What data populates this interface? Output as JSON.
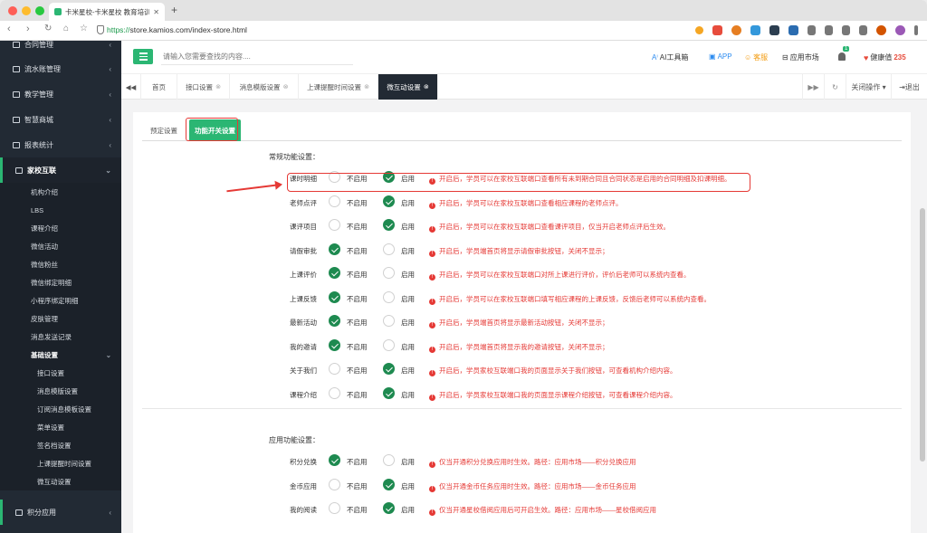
{
  "browser": {
    "tab_title": "卡米星校-卡米星校 教育培训机",
    "tab_close": "✕",
    "new_tab": "+",
    "url_scheme": "https://",
    "url_rest": "store.kamios.com/index-store.html"
  },
  "sidebar": {
    "items": [
      {
        "label": "合同管理",
        "icon": "contract-icon"
      },
      {
        "label": "流水账管理",
        "icon": "ledger-icon"
      },
      {
        "label": "教学管理",
        "icon": "calendar-icon"
      },
      {
        "label": "智慧商城",
        "icon": "shop-icon"
      },
      {
        "label": "报表统计",
        "icon": "chart-icon"
      },
      {
        "label": "家校互联",
        "icon": "chat-icon"
      },
      {
        "label": "积分应用",
        "icon": "points-icon"
      }
    ],
    "sub_items": [
      "机构介绍",
      "LBS",
      "课程介绍",
      "微信活动",
      "微信粉丝",
      "微信绑定明细",
      "小程序绑定明细",
      "皮肤管理",
      "消息发送记录",
      "基础设置"
    ],
    "sub2_items": [
      "接口设置",
      "消息模版设置",
      "订阅消息模板设置",
      "菜单设置",
      "签名档设置",
      "上课提醒时间设置",
      "微互动设置"
    ],
    "chevron": "‹",
    "chevron_open": "⌄"
  },
  "header": {
    "search_placeholder": "请输入您需要查找的内容....",
    "ai_label": "AI工具箱",
    "app_label": "APP",
    "service_label": "客服",
    "market_label": "应用市场",
    "bell_badge": "1",
    "health_label": "健康值",
    "health_value": "235"
  },
  "page_tabs": {
    "prev": "◀◀",
    "tabs": [
      {
        "label": "首页",
        "closable": false
      },
      {
        "label": "接口设置",
        "closable": true
      },
      {
        "label": "消息模版设置",
        "closable": true
      },
      {
        "label": "上课提醒时间设置",
        "closable": true
      },
      {
        "label": "微互动设置",
        "closable": true
      }
    ],
    "next": "▶▶",
    "refresh": "↻",
    "close_ops": "关闭操作 ▾",
    "logout": "退出"
  },
  "subtabs": [
    "预定设置",
    "功能开关设置"
  ],
  "sections": [
    {
      "title": "常规功能设置：",
      "rows": [
        {
          "label": "课时明细",
          "enabled": true,
          "hint": "开启后，学员可以在家校互联端口查看所有未到期合同且合同状态是启用的合同明细及扣课明细。"
        },
        {
          "label": "老师点评",
          "enabled": true,
          "hint": "开启后，学员可以在家校互联端口查看相应课程的老师点评。"
        },
        {
          "label": "课评项目",
          "enabled": true,
          "hint": "开启后，学员可以在家校互联端口查看课评项目，仅当开启老师点评后生效。"
        },
        {
          "label": "请假审批",
          "enabled": false,
          "hint": "开启后，学员端首页将显示请假审批按钮，关闭不显示；"
        },
        {
          "label": "上课评价",
          "enabled": false,
          "hint": "开启后，学员可以在家校互联端口对所上课进行评价，评价后老师可以系统内查看。"
        },
        {
          "label": "上课反馈",
          "enabled": false,
          "hint": "开启后，学员可以在家校互联端口填写相应课程的上课反馈，反馈后老师可以系统内查看。"
        },
        {
          "label": "最新活动",
          "enabled": false,
          "hint": "开启后，学员端首页将显示最新活动按钮，关闭不显示；"
        },
        {
          "label": "我的邀请",
          "enabled": false,
          "hint": "开启后，学员端首页将显示我的邀请按钮，关闭不显示；"
        },
        {
          "label": "关于我们",
          "enabled": true,
          "hint": "开启后，学员家校互联端口我的页面显示关于我们按钮，可查看机构介绍内容。"
        },
        {
          "label": "课程介绍",
          "enabled": true,
          "hint": "开启后，学员家校互联端口我的页面显示课程介绍按钮，可查看课程介绍内容。"
        }
      ]
    },
    {
      "title": "应用功能设置：",
      "rows": [
        {
          "label": "积分兑换",
          "enabled": false,
          "hint": "仅当开通积分兑换应用时生效。路径：应用市场——积分兑换应用"
        },
        {
          "label": "金币应用",
          "enabled": true,
          "hint": "仅当开通金币任务应用时生效。路径：应用市场——金币任务应用"
        },
        {
          "label": "我的阅读",
          "enabled": true,
          "hint": "仅当开通星校借阅应用后可开启生效。路径：应用市场——星校借阅应用"
        }
      ]
    }
  ],
  "radio_labels": {
    "off": "不启用",
    "on": "启用"
  },
  "colors": {
    "accent": "#2bb673",
    "sidebar": "#222a34",
    "hint": "#e53935",
    "checked": "#1e8a50"
  }
}
